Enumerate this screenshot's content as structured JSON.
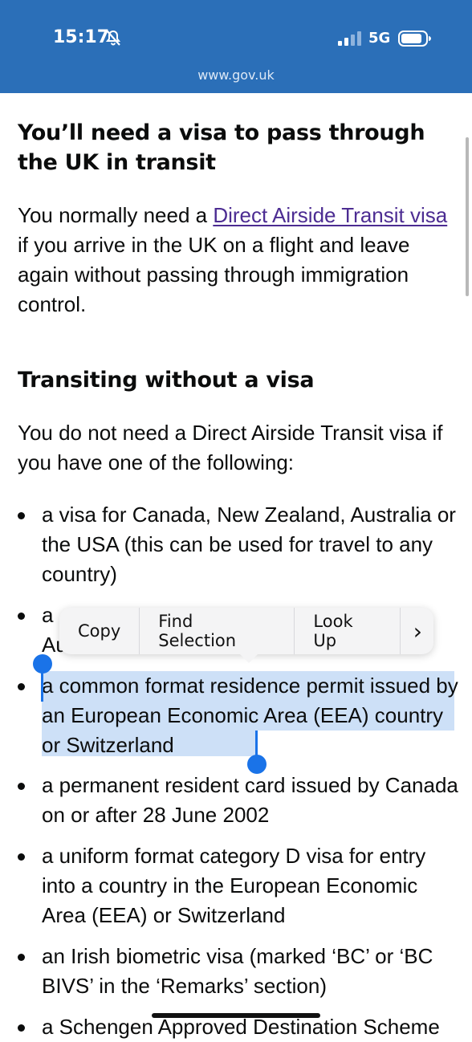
{
  "status_bar": {
    "time": "15:17",
    "network": "5G",
    "url": "www.gov.uk"
  },
  "article": {
    "heading1": "You’ll need a visa to pass through the UK in transit",
    "para1_prefix": "You normally need a ",
    "para1_link": "Direct Airside Transit visa",
    "para1_suffix": " if you arrive in the UK on a flight and leave again without passing through immigration control.",
    "heading2": "Transiting without a visa",
    "para2": "You do not need a Direct Airside Transit visa if you have one of the following:",
    "bullets": [
      "a visa for Canada, New Zealand, Australia or the USA (this can be used for travel to any country)",
      "a",
      "Au",
      "a common format residence permit issued by an European Economic Area (EEA) country or Switzerland",
      "a permanent resident card issued by Canada on or after 28 June 2002",
      "a uniform format category D visa for entry into a country in the European Economic Area (EEA) or Switzerland",
      "an Irish biometric visa (marked ‘BC’ or ‘BC BIVS’ in the ‘Remarks’ section)",
      "a Schengen Approved Destination Scheme"
    ]
  },
  "context_menu": {
    "items": [
      "Copy",
      "Find Selection",
      "Look Up"
    ],
    "more": "›"
  },
  "colors": {
    "header_bg": "#2b6fb8",
    "link": "#4c2c92",
    "selection": "#cde0f7",
    "handle": "#1a73e8"
  },
  "icons": [
    "bell-slash-icon",
    "signal-icon",
    "battery-icon",
    "chevron-right-icon"
  ]
}
